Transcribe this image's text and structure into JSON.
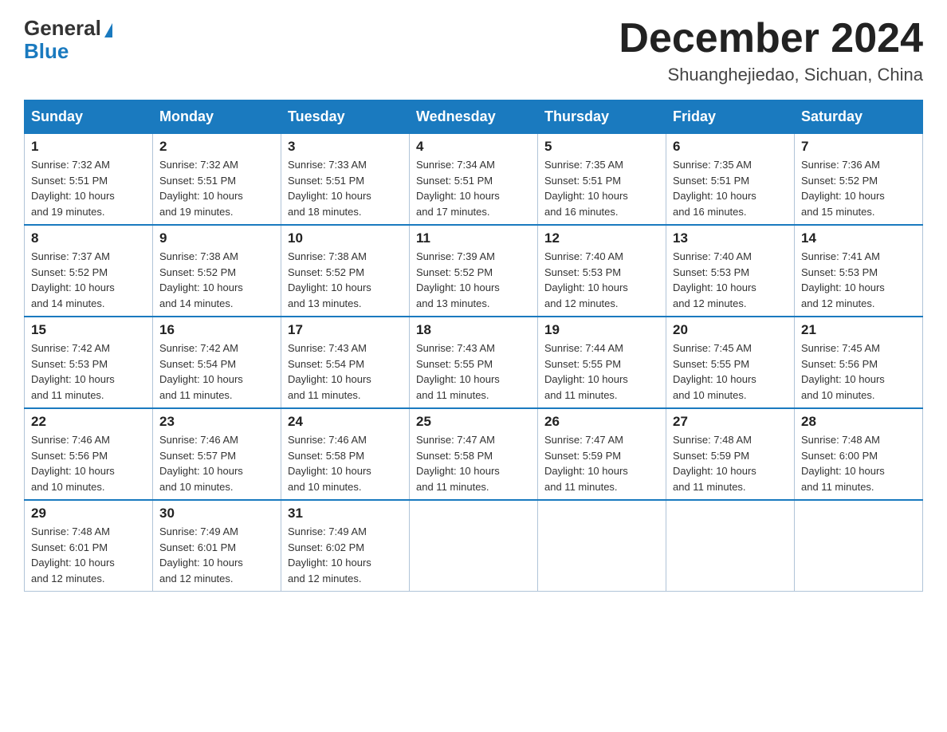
{
  "header": {
    "logo_general": "General",
    "logo_blue": "Blue",
    "month_title": "December 2024",
    "location": "Shuanghejiedao, Sichuan, China"
  },
  "weekdays": [
    "Sunday",
    "Monday",
    "Tuesday",
    "Wednesday",
    "Thursday",
    "Friday",
    "Saturday"
  ],
  "weeks": [
    [
      {
        "day": "1",
        "sunrise": "7:32 AM",
        "sunset": "5:51 PM",
        "daylight": "10 hours and 19 minutes."
      },
      {
        "day": "2",
        "sunrise": "7:32 AM",
        "sunset": "5:51 PM",
        "daylight": "10 hours and 19 minutes."
      },
      {
        "day": "3",
        "sunrise": "7:33 AM",
        "sunset": "5:51 PM",
        "daylight": "10 hours and 18 minutes."
      },
      {
        "day": "4",
        "sunrise": "7:34 AM",
        "sunset": "5:51 PM",
        "daylight": "10 hours and 17 minutes."
      },
      {
        "day": "5",
        "sunrise": "7:35 AM",
        "sunset": "5:51 PM",
        "daylight": "10 hours and 16 minutes."
      },
      {
        "day": "6",
        "sunrise": "7:35 AM",
        "sunset": "5:51 PM",
        "daylight": "10 hours and 16 minutes."
      },
      {
        "day": "7",
        "sunrise": "7:36 AM",
        "sunset": "5:52 PM",
        "daylight": "10 hours and 15 minutes."
      }
    ],
    [
      {
        "day": "8",
        "sunrise": "7:37 AM",
        "sunset": "5:52 PM",
        "daylight": "10 hours and 14 minutes."
      },
      {
        "day": "9",
        "sunrise": "7:38 AM",
        "sunset": "5:52 PM",
        "daylight": "10 hours and 14 minutes."
      },
      {
        "day": "10",
        "sunrise": "7:38 AM",
        "sunset": "5:52 PM",
        "daylight": "10 hours and 13 minutes."
      },
      {
        "day": "11",
        "sunrise": "7:39 AM",
        "sunset": "5:52 PM",
        "daylight": "10 hours and 13 minutes."
      },
      {
        "day": "12",
        "sunrise": "7:40 AM",
        "sunset": "5:53 PM",
        "daylight": "10 hours and 12 minutes."
      },
      {
        "day": "13",
        "sunrise": "7:40 AM",
        "sunset": "5:53 PM",
        "daylight": "10 hours and 12 minutes."
      },
      {
        "day": "14",
        "sunrise": "7:41 AM",
        "sunset": "5:53 PM",
        "daylight": "10 hours and 12 minutes."
      }
    ],
    [
      {
        "day": "15",
        "sunrise": "7:42 AM",
        "sunset": "5:53 PM",
        "daylight": "10 hours and 11 minutes."
      },
      {
        "day": "16",
        "sunrise": "7:42 AM",
        "sunset": "5:54 PM",
        "daylight": "10 hours and 11 minutes."
      },
      {
        "day": "17",
        "sunrise": "7:43 AM",
        "sunset": "5:54 PM",
        "daylight": "10 hours and 11 minutes."
      },
      {
        "day": "18",
        "sunrise": "7:43 AM",
        "sunset": "5:55 PM",
        "daylight": "10 hours and 11 minutes."
      },
      {
        "day": "19",
        "sunrise": "7:44 AM",
        "sunset": "5:55 PM",
        "daylight": "10 hours and 11 minutes."
      },
      {
        "day": "20",
        "sunrise": "7:45 AM",
        "sunset": "5:55 PM",
        "daylight": "10 hours and 10 minutes."
      },
      {
        "day": "21",
        "sunrise": "7:45 AM",
        "sunset": "5:56 PM",
        "daylight": "10 hours and 10 minutes."
      }
    ],
    [
      {
        "day": "22",
        "sunrise": "7:46 AM",
        "sunset": "5:56 PM",
        "daylight": "10 hours and 10 minutes."
      },
      {
        "day": "23",
        "sunrise": "7:46 AM",
        "sunset": "5:57 PM",
        "daylight": "10 hours and 10 minutes."
      },
      {
        "day": "24",
        "sunrise": "7:46 AM",
        "sunset": "5:58 PM",
        "daylight": "10 hours and 10 minutes."
      },
      {
        "day": "25",
        "sunrise": "7:47 AM",
        "sunset": "5:58 PM",
        "daylight": "10 hours and 11 minutes."
      },
      {
        "day": "26",
        "sunrise": "7:47 AM",
        "sunset": "5:59 PM",
        "daylight": "10 hours and 11 minutes."
      },
      {
        "day": "27",
        "sunrise": "7:48 AM",
        "sunset": "5:59 PM",
        "daylight": "10 hours and 11 minutes."
      },
      {
        "day": "28",
        "sunrise": "7:48 AM",
        "sunset": "6:00 PM",
        "daylight": "10 hours and 11 minutes."
      }
    ],
    [
      {
        "day": "29",
        "sunrise": "7:48 AM",
        "sunset": "6:01 PM",
        "daylight": "10 hours and 12 minutes."
      },
      {
        "day": "30",
        "sunrise": "7:49 AM",
        "sunset": "6:01 PM",
        "daylight": "10 hours and 12 minutes."
      },
      {
        "day": "31",
        "sunrise": "7:49 AM",
        "sunset": "6:02 PM",
        "daylight": "10 hours and 12 minutes."
      },
      null,
      null,
      null,
      null
    ]
  ]
}
